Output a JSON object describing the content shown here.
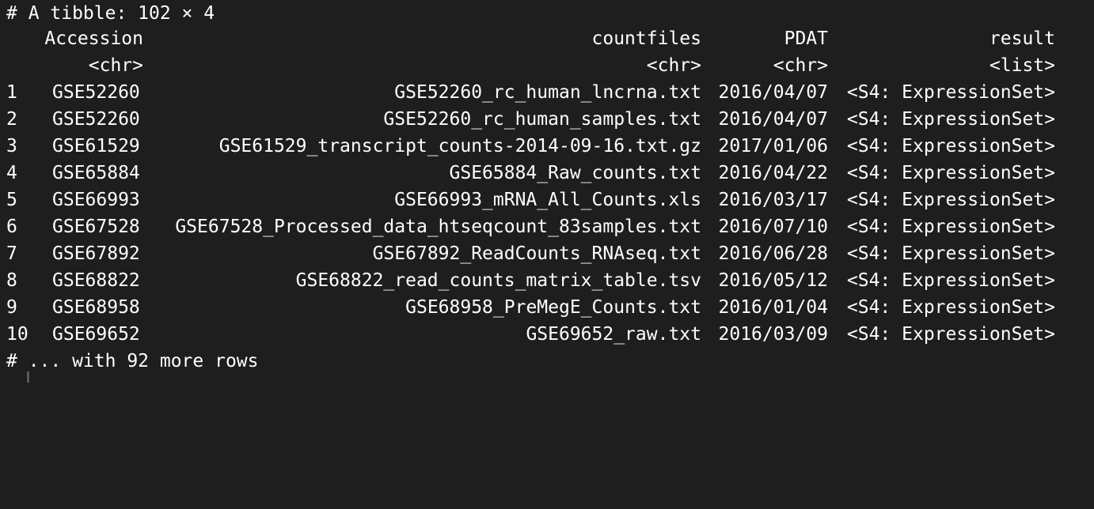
{
  "terminal": {
    "header": "# A tibble: 102 × 4",
    "footer": "# ... with 92 more rows",
    "columns": [
      {
        "name": "Accession",
        "type": "<chr>"
      },
      {
        "name": "countfiles",
        "type": "<chr>"
      },
      {
        "name": "PDAT",
        "type": "<chr>"
      },
      {
        "name": "result",
        "type": "<list>"
      }
    ],
    "rows": [
      {
        "idx": "1",
        "accession": "GSE52260",
        "countfiles": "GSE52260_rc_human_lncrna.txt",
        "pdat": "2016/04/07",
        "result": "<S4: ExpressionSet>"
      },
      {
        "idx": "2",
        "accession": "GSE52260",
        "countfiles": "GSE52260_rc_human_samples.txt",
        "pdat": "2016/04/07",
        "result": "<S4: ExpressionSet>"
      },
      {
        "idx": "3",
        "accession": "GSE61529",
        "countfiles": "GSE61529_transcript_counts-2014-09-16.txt.gz",
        "pdat": "2017/01/06",
        "result": "<S4: ExpressionSet>"
      },
      {
        "idx": "4",
        "accession": "GSE65884",
        "countfiles": "GSE65884_Raw_counts.txt",
        "pdat": "2016/04/22",
        "result": "<S4: ExpressionSet>"
      },
      {
        "idx": "5",
        "accession": "GSE66993",
        "countfiles": "GSE66993_mRNA_All_Counts.xls",
        "pdat": "2016/03/17",
        "result": "<S4: ExpressionSet>"
      },
      {
        "idx": "6",
        "accession": "GSE67528",
        "countfiles": "GSE67528_Processed_data_htseqcount_83samples.txt",
        "pdat": "2016/07/10",
        "result": "<S4: ExpressionSet>"
      },
      {
        "idx": "7",
        "accession": "GSE67892",
        "countfiles": "GSE67892_ReadCounts_RNAseq.txt",
        "pdat": "2016/06/28",
        "result": "<S4: ExpressionSet>"
      },
      {
        "idx": "8",
        "accession": "GSE68822",
        "countfiles": "GSE68822_read_counts_matrix_table.tsv",
        "pdat": "2016/05/12",
        "result": "<S4: ExpressionSet>"
      },
      {
        "idx": "9",
        "accession": "GSE68958",
        "countfiles": "GSE68958_PreMegE_Counts.txt",
        "pdat": "2016/01/04",
        "result": "<S4: ExpressionSet>"
      },
      {
        "idx": "10",
        "accession": "GSE69652",
        "countfiles": "GSE69652_raw.txt",
        "pdat": "2016/03/09",
        "result": "<S4: ExpressionSet>"
      }
    ]
  },
  "colors": {
    "background": "#1e1e1e",
    "text": "#ffffff"
  }
}
